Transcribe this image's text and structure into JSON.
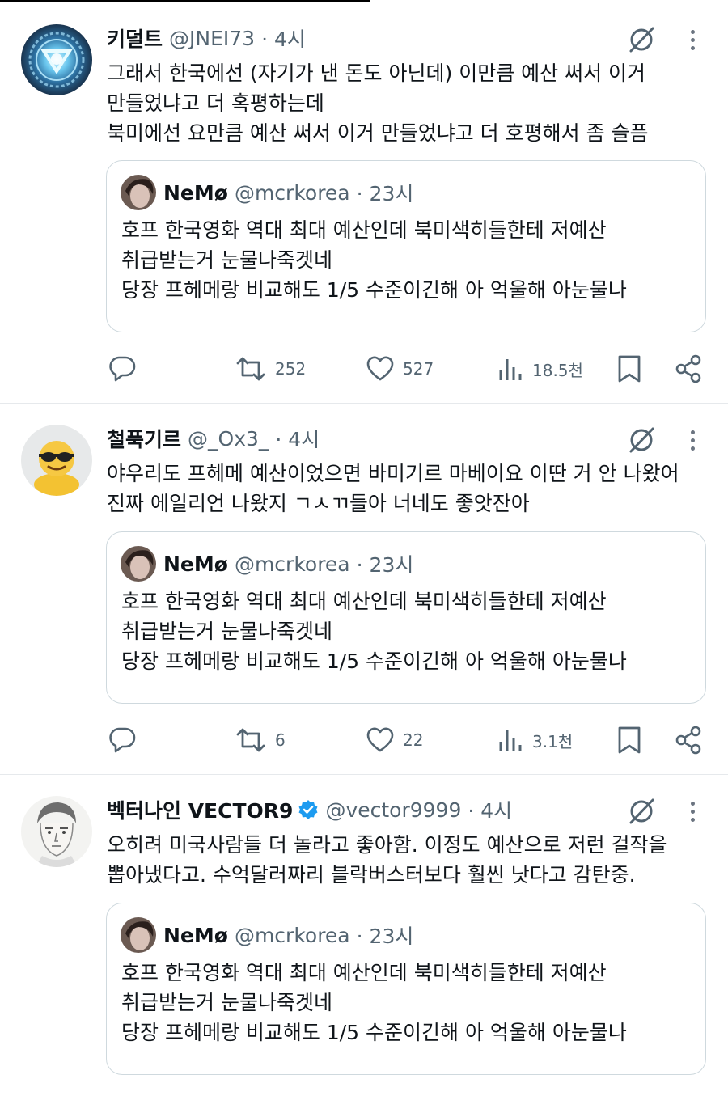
{
  "tweets": [
    {
      "name": "키덜트",
      "handle": "@JNEI73",
      "time": "· 4시",
      "verified": false,
      "avatar_icon": "arc-reactor-icon",
      "lines": [
        "그래서 한국에선 (자기가 낸 돈도 아닌데) 이만큼 예산 써서 이거",
        "만들었냐고 더 혹평하는데",
        "북미에선 요만큼 예산 써서 이거 만들었냐고 더 호평해서 좀 슬픔"
      ],
      "quote": {
        "name": "NeMø",
        "handle": "@mcrkorea",
        "time": "· 23시",
        "lines": [
          "호프 한국영화 역대 최대 예산인데 북미색히들한테 저예산",
          "취급받는거 눈물나죽겟네",
          "당장 프헤메랑 비교해도 1/5 수준이긴해 아 억울해 아눈물나"
        ]
      },
      "stats": {
        "retweets": "252",
        "likes": "527",
        "views": "18.5천"
      }
    },
    {
      "name": "철푹기르",
      "handle": "@_Ox3_",
      "time": "· 4시",
      "verified": false,
      "avatar_icon": "sunglasses-emoji-icon",
      "lines": [
        "야우리도 프헤메 예산이었으면 바미기르 마베이요 이딴 거 안 나왔어",
        "진짜 에일리언 나왔지 ㄱㅅㄲ들아 너네도 좋앗잔아"
      ],
      "quote": {
        "name": "NeMø",
        "handle": "@mcrkorea",
        "time": "· 23시",
        "lines": [
          "호프 한국영화 역대 최대 예산인데 북미색히들한테 저예산",
          "취급받는거 눈물나죽겟네",
          "당장 프헤메랑 비교해도 1/5 수준이긴해 아 억울해 아눈물나"
        ]
      },
      "stats": {
        "retweets": "6",
        "likes": "22",
        "views": "3.1천"
      }
    },
    {
      "name": "벡터나인 VECTOR9",
      "handle": "@vector9999",
      "time": "· 4시",
      "verified": true,
      "avatar_icon": "sketch-face-icon",
      "lines": [
        "오히려 미국사람들 더 놀라고 좋아함. 이정도 예산으로 저런 걸작을",
        "뽑아냈다고. 수억달러짜리 블락버스터보다 훨씬 낫다고 감탄중."
      ],
      "quote": {
        "name": "NeMø",
        "handle": "@mcrkorea",
        "time": "· 23시",
        "lines": [
          "호프 한국영화 역대 최대 예산인데 북미색히들한테 저예산",
          "취급받는거 눈물나죽겟네",
          "당장 프헤메랑 비교해도 1/5 수준이긴해 아 억울해 아눈물나"
        ]
      }
    }
  ],
  "colors": {
    "text": "#0f1419",
    "secondary": "#536471",
    "border": "#cfd9de",
    "verified": "#1d9bf0"
  }
}
